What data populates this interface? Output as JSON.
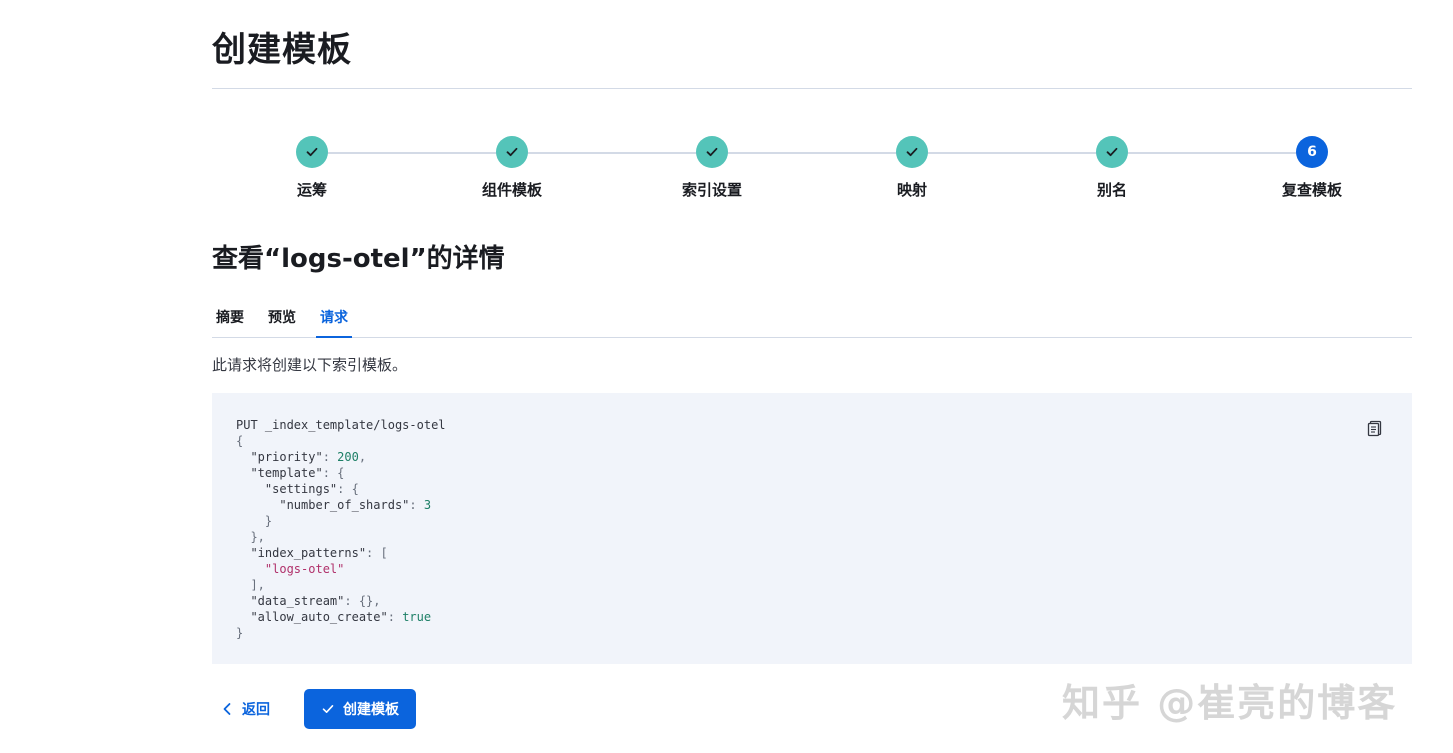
{
  "page": {
    "title": "创建模板"
  },
  "steps": [
    {
      "label": "运筹",
      "status": "complete"
    },
    {
      "label": "组件模板",
      "status": "complete"
    },
    {
      "label": "索引设置",
      "status": "complete"
    },
    {
      "label": "映射",
      "status": "complete"
    },
    {
      "label": "别名",
      "status": "complete"
    },
    {
      "label": "复查模板",
      "status": "current",
      "number": "6"
    }
  ],
  "detail": {
    "title": "查看“logs-otel”的详情"
  },
  "tabs": [
    {
      "label": "摘要",
      "active": false
    },
    {
      "label": "预览",
      "active": false
    },
    {
      "label": "请求",
      "active": true
    }
  ],
  "request": {
    "description": "此请求将创建以下索引模板。",
    "method_line": "PUT _index_template/logs-otel",
    "priority": "200",
    "number_of_shards": "3",
    "index_pattern": "\"logs-otel\"",
    "allow_auto_create": "true"
  },
  "footer": {
    "back_label": "返回",
    "create_label": "创建模板"
  },
  "watermark": "知乎 @崔亮的博客",
  "icons": {
    "copy": "clipboard-icon",
    "check": "check-icon",
    "back": "chevron-left-icon"
  },
  "colors": {
    "step_complete": "#54c4b9",
    "step_current": "#0b64dd",
    "primary": "#0b64dd",
    "code_bg": "#f1f4fa"
  }
}
